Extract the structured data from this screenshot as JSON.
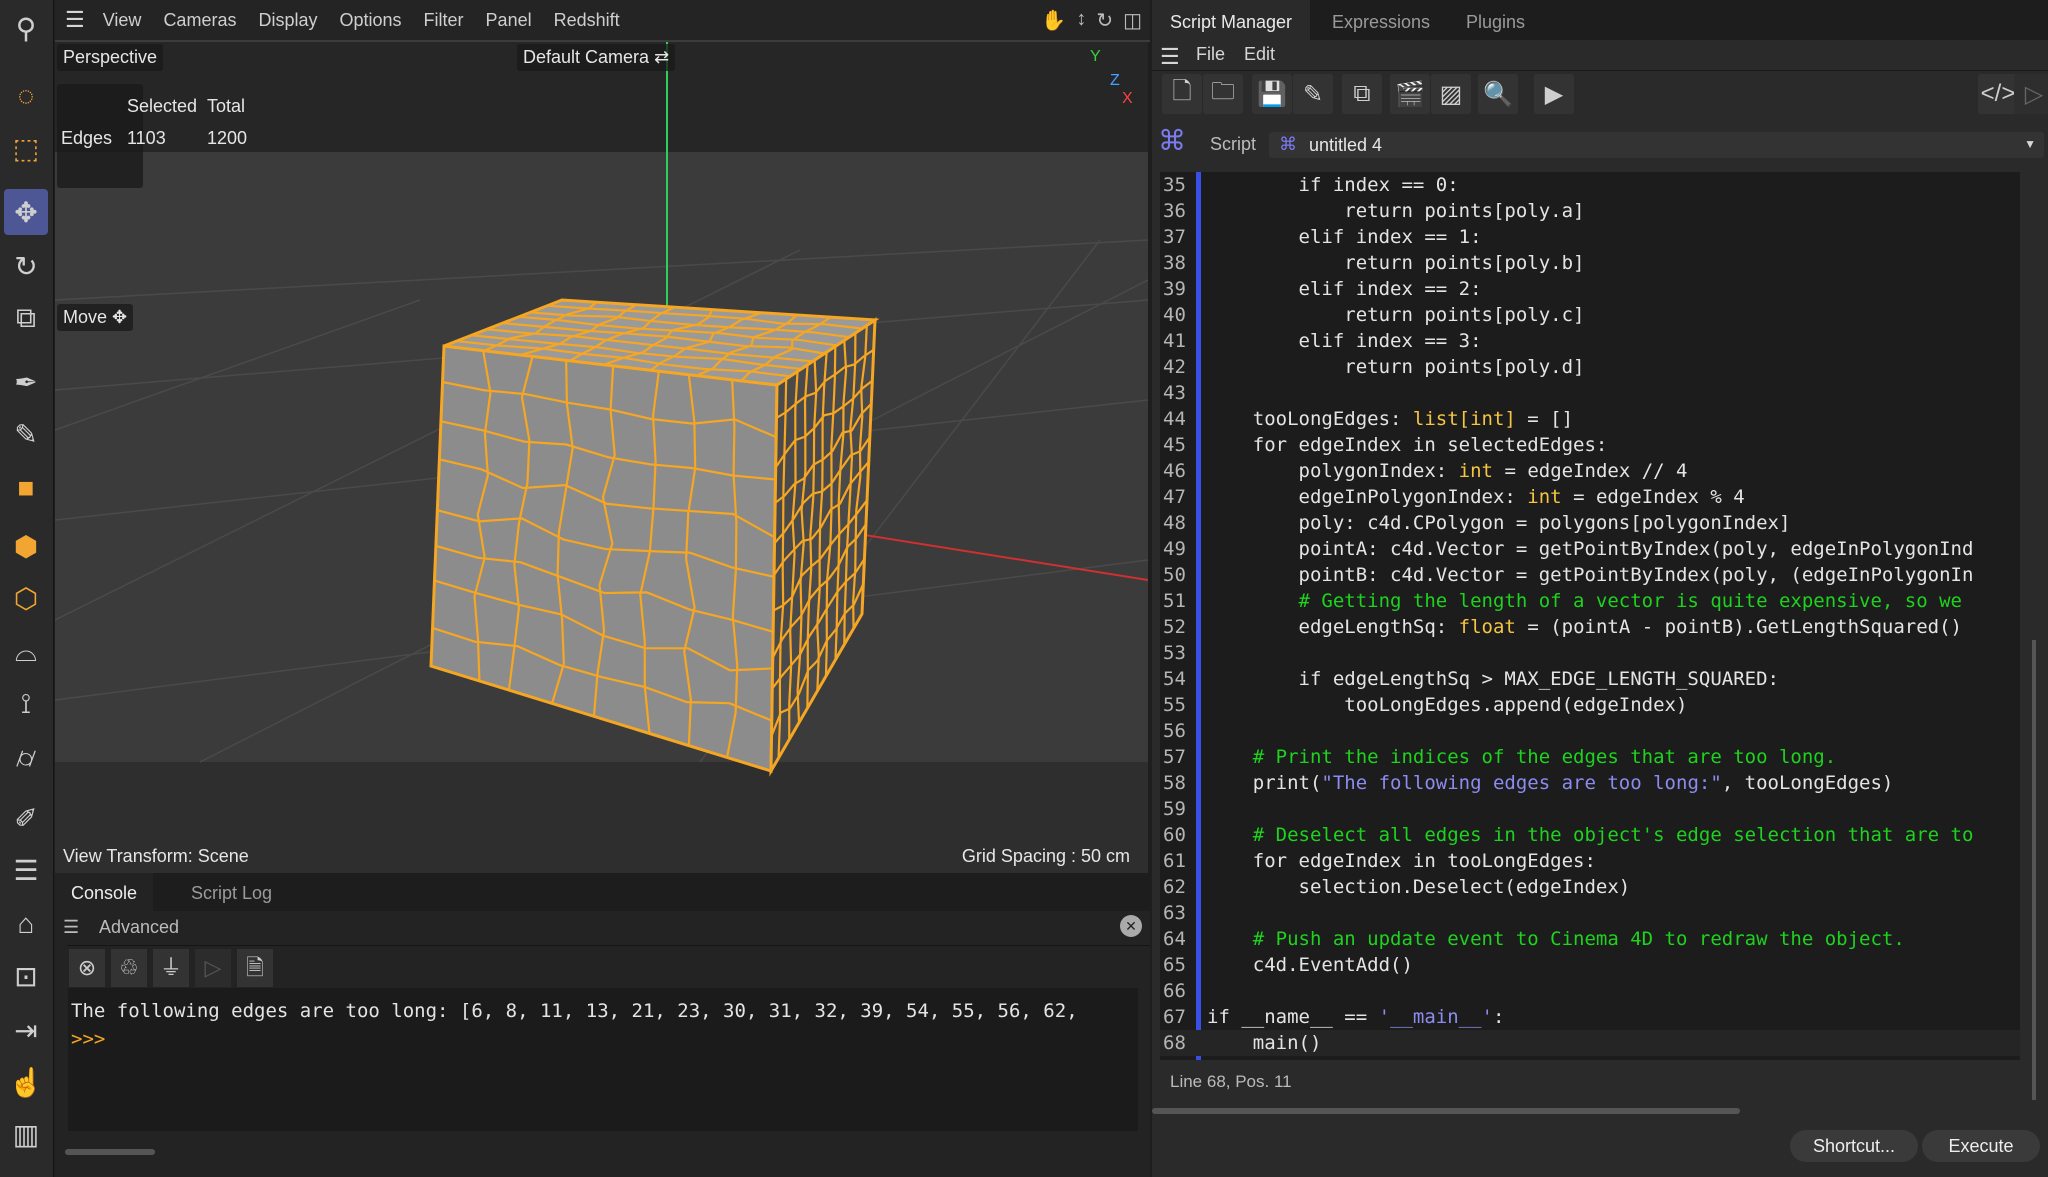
{
  "left_toolbar": [
    "search-icon",
    "live-selection-icon",
    "rectangle-selection-icon",
    "move-icon",
    "rotate-icon",
    "scale-icon",
    "pen-icon",
    "sketch-icon",
    "polygon-icon",
    "cube-icon",
    "extrude-icon",
    "bridge-icon",
    "mirror-icon",
    "cylinder-icon",
    "knife-icon",
    "loop-icon",
    "iron-icon",
    "focus-icon",
    "align-icon",
    "magnet-icon",
    "columns-icon"
  ],
  "viewport": {
    "menu": [
      "View",
      "Cameras",
      "Display",
      "Options",
      "Filter",
      "Panel",
      "Redshift"
    ],
    "camera_mode": "Perspective",
    "camera": "Default Camera",
    "stats": {
      "col_selected": "Selected",
      "col_total": "Total",
      "row_label": "Edges",
      "selected": "1103",
      "total": "1200"
    },
    "tool": "Move",
    "view_transform": "View Transform: Scene",
    "grid_spacing": "Grid Spacing : 50 cm",
    "axes": {
      "y": "Y",
      "z": "Z",
      "x": "X"
    },
    "selection_color": "#f5a623"
  },
  "console": {
    "tabs": [
      "Console",
      "Script Log"
    ],
    "menu_label": "Advanced",
    "output": "The following edges are too long: [6, 8, 11, 13, 21, 23, 30, 31, 32, 39, 54, 55, 56, 62,",
    "prompt": ">>>"
  },
  "script_manager": {
    "tabs": [
      "Script Manager",
      "Expressions",
      "Plugins"
    ],
    "menu": [
      "File",
      "Edit"
    ],
    "script_label": "Script",
    "script_name": "untitled 4",
    "status": "Line 68, Pos. 11",
    "shortcut_label": "Shortcut...",
    "execute_label": "Execute",
    "code": [
      [
        35,
        [
          [
            "        if index == 0:",
            ""
          ]
        ]
      ],
      [
        36,
        [
          [
            "            return points[poly.a]",
            ""
          ]
        ]
      ],
      [
        37,
        [
          [
            "        elif index == 1:",
            ""
          ]
        ]
      ],
      [
        38,
        [
          [
            "            return points[poly.b]",
            ""
          ]
        ]
      ],
      [
        39,
        [
          [
            "        elif index == 2:",
            ""
          ]
        ]
      ],
      [
        40,
        [
          [
            "            return points[poly.c]",
            ""
          ]
        ]
      ],
      [
        41,
        [
          [
            "        elif index == 3:",
            ""
          ]
        ]
      ],
      [
        42,
        [
          [
            "            return points[poly.d]",
            ""
          ]
        ]
      ],
      [
        43,
        []
      ],
      [
        44,
        [
          [
            "    tooLongEdges: ",
            ""
          ],
          [
            "list[int]",
            "k"
          ],
          [
            " = []",
            ""
          ]
        ]
      ],
      [
        45,
        [
          [
            "    for edgeIndex in selectedEdges:",
            ""
          ]
        ]
      ],
      [
        46,
        [
          [
            "        polygonIndex: ",
            ""
          ],
          [
            "int",
            "k"
          ],
          [
            " = edgeIndex // 4",
            ""
          ]
        ]
      ],
      [
        47,
        [
          [
            "        edgeInPolygonIndex: ",
            ""
          ],
          [
            "int",
            "k"
          ],
          [
            " = edgeIndex % 4",
            ""
          ]
        ]
      ],
      [
        48,
        [
          [
            "        poly: c4d.CPolygon = polygons[polygonIndex]",
            ""
          ]
        ]
      ],
      [
        49,
        [
          [
            "        pointA: c4d.Vector = getPointByIndex(poly, edgeInPolygonInd",
            ""
          ]
        ]
      ],
      [
        50,
        [
          [
            "        pointB: c4d.Vector = getPointByIndex(poly, (edgeInPolygonIn",
            ""
          ]
        ]
      ],
      [
        51,
        [
          [
            "        # Getting the length of a vector is quite expensive, so we ",
            "c"
          ]
        ]
      ],
      [
        52,
        [
          [
            "        edgeLengthSq: ",
            ""
          ],
          [
            "float",
            "k"
          ],
          [
            " = (pointA - pointB).GetLengthSquared()",
            ""
          ]
        ]
      ],
      [
        53,
        []
      ],
      [
        54,
        [
          [
            "        if edgeLengthSq > MAX_EDGE_LENGTH_SQUARED:",
            ""
          ]
        ]
      ],
      [
        55,
        [
          [
            "            tooLongEdges.append(edgeIndex)",
            ""
          ]
        ]
      ],
      [
        56,
        []
      ],
      [
        57,
        [
          [
            "    # Print the indices of the edges that are too long.",
            "c"
          ]
        ]
      ],
      [
        58,
        [
          [
            "    print(",
            ""
          ],
          [
            "\"The following edges are too long:\"",
            "s"
          ],
          [
            ", tooLongEdges)",
            ""
          ]
        ]
      ],
      [
        59,
        []
      ],
      [
        60,
        [
          [
            "    # Deselect all edges in the object's edge selection that are to",
            "c"
          ]
        ]
      ],
      [
        61,
        [
          [
            "    for edgeIndex in tooLongEdges:",
            ""
          ]
        ]
      ],
      [
        62,
        [
          [
            "        selection.Deselect(edgeIndex)",
            ""
          ]
        ]
      ],
      [
        63,
        []
      ],
      [
        64,
        [
          [
            "    # Push an update event to Cinema 4D to redraw the object.",
            "c"
          ]
        ]
      ],
      [
        65,
        [
          [
            "    c4d.EventAdd()",
            ""
          ]
        ]
      ],
      [
        66,
        []
      ],
      [
        67,
        [
          [
            "if __name__ == ",
            ""
          ],
          [
            "'__main__'",
            "s"
          ],
          [
            ":",
            ""
          ]
        ]
      ],
      [
        68,
        [
          [
            "    main()",
            ""
          ]
        ]
      ]
    ]
  }
}
